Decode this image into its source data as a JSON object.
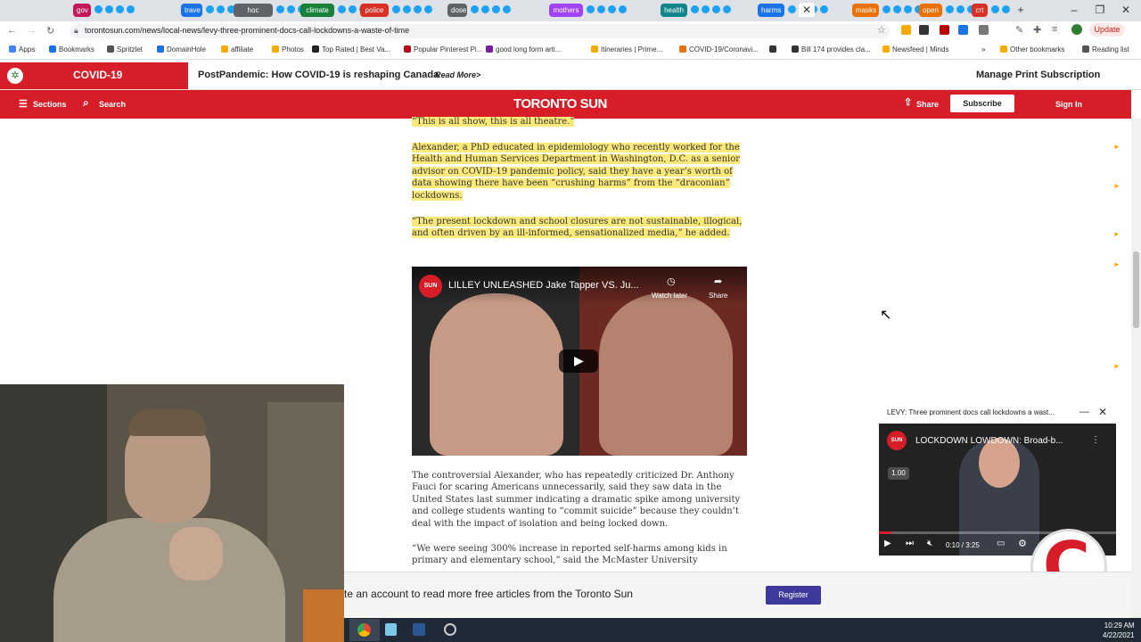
{
  "browser": {
    "tab_groups": [
      {
        "label": "gov",
        "color": "#c2185b"
      },
      {
        "label": "trave",
        "color": "#1a73e8"
      },
      {
        "label": "hoc nudes",
        "color": "#5f6368"
      },
      {
        "label": "climate",
        "color": "#188038"
      },
      {
        "label": "police",
        "color": "#d93025"
      },
      {
        "label": "dose",
        "color": "#5f6368"
      },
      {
        "label": "mothers",
        "color": "#a142f4"
      },
      {
        "label": "health",
        "color": "#12858a"
      },
      {
        "label": "harms",
        "color": "#1a73e8"
      },
      {
        "label": "masks",
        "color": "#e8710a"
      },
      {
        "label": "open",
        "color": "#e8710a"
      },
      {
        "label": "crt",
        "color": "#d93025"
      }
    ],
    "new_tab_icon": "plus-icon",
    "url": "torontosun.com/news/local-news/levy-three-prominent-docs-call-lockdowns-a-waste-of-time",
    "update_label": "Update",
    "bookmarks": [
      {
        "label": "Apps",
        "color": "#4285f4"
      },
      {
        "label": "Bookmarks",
        "color": "#1a73e8"
      },
      {
        "label": "Spritzlet",
        "color": "#555555"
      },
      {
        "label": "DomainHole",
        "color": "#1a73e8"
      },
      {
        "label": "affiliate",
        "color": "#f9ab00"
      },
      {
        "label": "Photos",
        "color": "#f9ab00"
      },
      {
        "label": "Top Rated | Best Va...",
        "color": "#222222"
      },
      {
        "label": "Popular Pinterest Pi...",
        "color": "#bd081c"
      },
      {
        "label": "good long form arti...",
        "color": "#7b1fa2"
      },
      {
        "label": "Itineraries | Prime...",
        "color": "#f9ab00"
      },
      {
        "label": "COVID-19/Coronavi...",
        "color": "#e8710a"
      },
      {
        "label": "",
        "color": "#333333"
      },
      {
        "label": "Bill 174 provides cla...",
        "color": "#333333"
      },
      {
        "label": "Newsfeed | Minds",
        "color": "#f9ab00"
      }
    ],
    "other_bookmarks": "Other bookmarks",
    "reading_list": "Reading list"
  },
  "site": {
    "covid_label": "COVID-19",
    "promo_text": "PostPandemic: How COVID-19 is reshaping Canada",
    "promo_link": "Read More>",
    "manage_print": "Manage Print Subscription",
    "sections_label": "Sections",
    "search_label": "Search",
    "logo_text": "TORONTO SUN",
    "share_label": "Share",
    "subscribe_label": "Subscribe",
    "signin_label": "Sign In"
  },
  "article": {
    "quote1": "“This is all show, this is all theatre.”",
    "para1": "Alexander, a PhD educated in epidemiology who recently worked for the Health and Human Services Department in Washington, D.C. as a senior advisor on COVID-19 pandemic policy, said they have a year’s worth of data showing there have been “crushing harms” from the “draconian” lockdowns.",
    "para2": "“The present lockdown and school closures are not sustainable, illogical, and often driven by an ill-informed, sensationalized media,” he added.",
    "video_channel": "TORONTO SUN",
    "video_title": "LILLEY UNLEASHED Jake Tapper VS. Ju...",
    "watch_later": "Watch later",
    "share": "Share",
    "para3": "The controversial Alexander, who has repeatedly criticized Dr. Anthony Fauci for scaring Americans unnecessarily, said they saw data in the United States last summer indicating a dramatic spike among university and college students wanting to “commit suicide” because they couldn’t deal with the impact of isolation and being locked down.",
    "para4": "“We were seeing 300% increase in reported self-harms among kids in primary and elementary school,” said the McMaster University"
  },
  "mini_player": {
    "header": "LEVY: Three prominent docs call lockdowns a wast...",
    "title": "LOCKDOWN LOWDOWN: Broad-b...",
    "speed": "1.00",
    "time": "0:10 / 3:25"
  },
  "register_banner": {
    "text": "te an account to read more free articles from the Toronto Sun",
    "button": "Register"
  },
  "overlay": {
    "logo_letter": "C"
  },
  "taskbar": {
    "time": "10:29 AM",
    "date": "4/22/2021"
  },
  "colors": {
    "brand_red": "#d71e28",
    "highlight": "#fbe97a",
    "register_blue": "#3d3a9b"
  }
}
